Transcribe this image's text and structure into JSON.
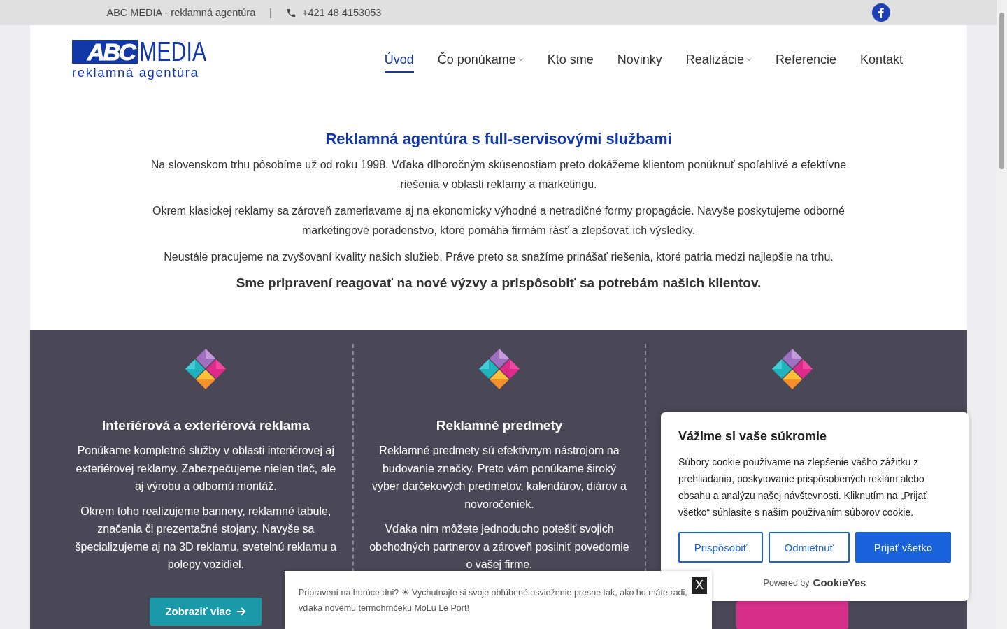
{
  "top_bar": {
    "company": "ABC MEDIA - reklamná agentúra",
    "separator": "|",
    "phone": "+421 48 4153053"
  },
  "logo": {
    "mark": "ABC",
    "name": "MEDIA",
    "tagline": "reklamná agentúra"
  },
  "nav": [
    {
      "label": "Úvod",
      "selected": true,
      "dropdown": false
    },
    {
      "label": "Čo ponúkame",
      "selected": false,
      "dropdown": true
    },
    {
      "label": "Kto sme",
      "selected": false,
      "dropdown": false
    },
    {
      "label": "Novinky",
      "selected": false,
      "dropdown": false
    },
    {
      "label": "Realizácie",
      "selected": false,
      "dropdown": true
    },
    {
      "label": "Referencie",
      "selected": false,
      "dropdown": false
    },
    {
      "label": "Kontakt",
      "selected": false,
      "dropdown": false
    }
  ],
  "intro": {
    "title": "Reklamná agentúra s full-servisovými službami",
    "paragraphs": [
      "Na slovenskom trhu pôsobíme už od roku 1998. Vďaka dlhoročným skúsenostiam preto dokážeme klientom ponúknuť spoľahlivé a efektívne riešenia v oblasti reklamy a marketingu.",
      "Okrem klasickej reklamy sa zároveň zameriavame aj na ekonomicky výhodné a netradičné formy propagácie. Navyše poskytujeme odborné marketingové poradenstvo, ktoré pomáha firmám rásť a zlepšovať ich výsledky.",
      "Neustále pracujeme na zvyšovaní kvality našich služieb. Práve preto sa snažíme prinášať riešenia, ktoré patria medzi najlepšie na trhu."
    ],
    "tagline": "Sme pripravení reagovať na nové výzvy a prispôsobiť sa potrebám našich klientov."
  },
  "services": [
    {
      "title": "Interiérová a exteriérová reklama",
      "paragraphs": [
        "Ponúkame kompletné služby v oblasti interiérovej aj exteriérovej reklamy. Zabezpečujeme nielen tlač, ale aj výrobu a odbornú montáž.",
        "Okrem toho realizujeme bannery, reklamné tabule, značenia či prezentačné stojany. Navyše sa špecializujeme aj na 3D reklamu, svetelnú reklamu a polepy vozidiel."
      ],
      "button": {
        "label": "Zobraziť viac",
        "color": "#1a9aa8"
      }
    },
    {
      "title": "Reklamné predmety",
      "paragraphs": [
        "Reklamné predmety sú efektívnym nástrojom na budovanie značky. Preto vám ponúkame široký výber darčekových predmetov, kalendárov, diárov a novoročeniek.",
        "Vďaka nim môžete jednoducho potešiť svojich obchodných partnerov a zároveň posilniť povedomie o vašej firme."
      ]
    },
    {
      "button": {
        "color": "#d6308a"
      }
    }
  ],
  "cookie_banner": {
    "title": "Vážime si vaše súkromie",
    "text": "Súbory cookie používame na zlepšenie vášho zážitku z prehliadania, poskytovanie prispôsobených reklám alebo obsahu a analýzu našej návštevnosti. Kliknutím na „Prijať všetko“ súhlasíte s naším používaním súborov cookie.",
    "buttons": [
      {
        "label": "Prispôsobiť",
        "kind": "outline"
      },
      {
        "label": "Odmietnuť",
        "kind": "outline"
      },
      {
        "label": "Prijať všetko",
        "kind": "primary"
      }
    ],
    "powered_by": "Powered by",
    "brand": "CookieYes"
  },
  "notice": {
    "text": "Pripravení na horúce dni? ☀ Vychutnajte si svoje obľúbené osvieženie presne tak, ako ho máte radi,",
    "text_2": "vďaka novému",
    "link": "termohrnčeku MoLu Le Port",
    "end": "!",
    "close": "X"
  }
}
